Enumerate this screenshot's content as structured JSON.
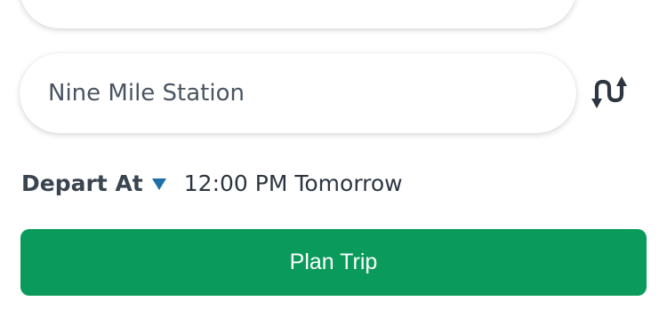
{
  "trip_form": {
    "origin_field": {
      "value": ""
    },
    "destination_field": {
      "value": "Nine Mile Station"
    },
    "depart": {
      "label": "Depart At",
      "time": "12:00 PM Tomorrow"
    },
    "plan_button_label": "Plan Trip"
  },
  "icons": {
    "menu": "more-vertical-icon",
    "swap": "swap-vertical-icon",
    "dropdown": "caret-down-icon"
  },
  "colors": {
    "primary_button": "#0a9a5b",
    "caret": "#1f6fa8",
    "text_dark": "#2d3640"
  }
}
